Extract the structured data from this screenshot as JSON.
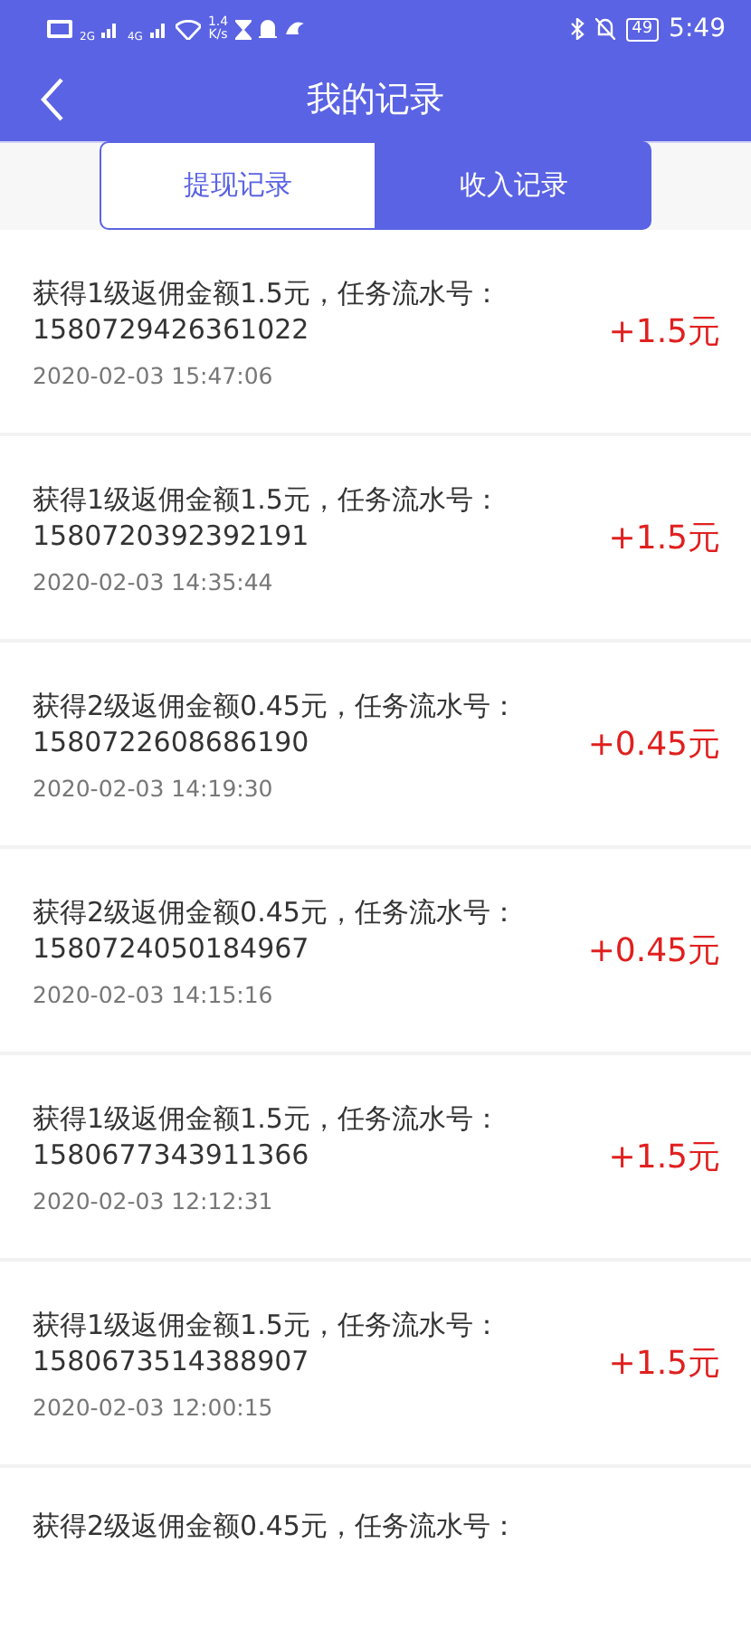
{
  "status_bar": {
    "network_labels": [
      "2G",
      "4G"
    ],
    "speed_value": "1.4",
    "speed_unit": "K/s",
    "battery": "49",
    "time": "5:49"
  },
  "header": {
    "title": "我的记录"
  },
  "tabs": [
    {
      "label": "提现记录",
      "selected": false
    },
    {
      "label": "收入记录",
      "selected": true
    }
  ],
  "records": [
    {
      "text": "获得1级返佣金额1.5元，任务流水号：",
      "serial": "1580729426361022",
      "time": "2020-02-03 15:47:06",
      "amount": "+1.5元"
    },
    {
      "text": "获得1级返佣金额1.5元，任务流水号：",
      "serial": "1580720392392191",
      "time": "2020-02-03 14:35:44",
      "amount": "+1.5元"
    },
    {
      "text": "获得2级返佣金额0.45元，任务流水号：",
      "serial": "1580722608686190",
      "time": "2020-02-03 14:19:30",
      "amount": "+0.45元"
    },
    {
      "text": "获得2级返佣金额0.45元，任务流水号：",
      "serial": "1580724050184967",
      "time": "2020-02-03 14:15:16",
      "amount": "+0.45元"
    },
    {
      "text": "获得1级返佣金额1.5元，任务流水号：",
      "serial": "1580677343911366",
      "time": "2020-02-03 12:12:31",
      "amount": "+1.5元"
    },
    {
      "text": "获得1级返佣金额1.5元，任务流水号：",
      "serial": "1580673514388907",
      "time": "2020-02-03 12:00:15",
      "amount": "+1.5元"
    },
    {
      "text": "获得2级返佣金额0.45元，任务流水号："
    }
  ]
}
